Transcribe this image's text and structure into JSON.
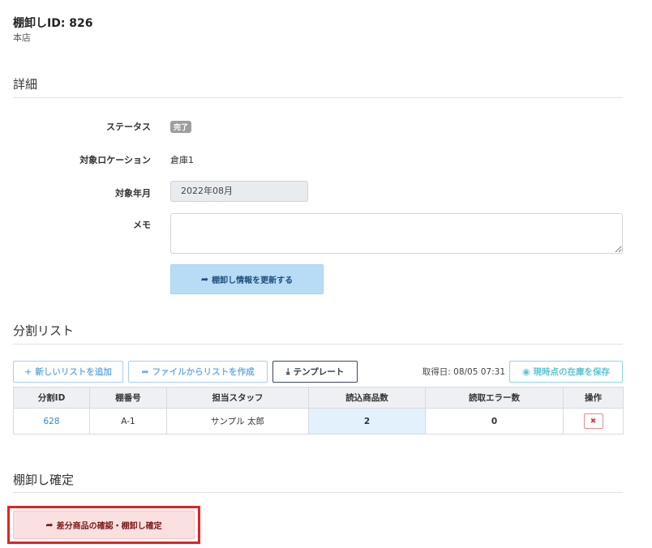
{
  "header": {
    "title": "棚卸しID: 826",
    "subtitle": "本店"
  },
  "details": {
    "section_title": "詳細",
    "status_label": "ステータス",
    "status_value": "完了",
    "location_label": "対象ロケーション",
    "location_value": "倉庫1",
    "month_label": "対象年月",
    "month_value": "2022年08月",
    "memo_label": "メモ",
    "memo_value": "",
    "update_button": "棚卸し情報を更新する"
  },
  "split": {
    "section_title": "分割リスト",
    "add_button": "新しいリストを追加",
    "file_button": "ファイルからリストを作成",
    "template_button": "テンプレート",
    "fetch_date": "取得日: 08/05 07:31",
    "save_button": "現時点の在庫を保存",
    "columns": [
      "分割ID",
      "棚番号",
      "担当スタッフ",
      "読込商品数",
      "読取エラー数",
      "操作"
    ],
    "rows": [
      {
        "id": "628",
        "shelf": "A-1",
        "staff": "サンプル 太郎",
        "read_count": "2",
        "error_count": "0"
      }
    ]
  },
  "confirm": {
    "section_title": "棚卸し確定",
    "button": "差分商品の確認・棚卸し確定"
  },
  "colors": {
    "accent_blue": "#6faee0",
    "teal": "#5cc5d0",
    "danger": "#d04343",
    "highlight_box": "#e52222"
  },
  "icons": {
    "update": "share-arrow-icon",
    "add": "plus-icon",
    "file": "share-arrow-icon",
    "template": "download-icon",
    "save": "camera-icon",
    "delete": "close-icon",
    "confirm": "share-arrow-icon"
  }
}
